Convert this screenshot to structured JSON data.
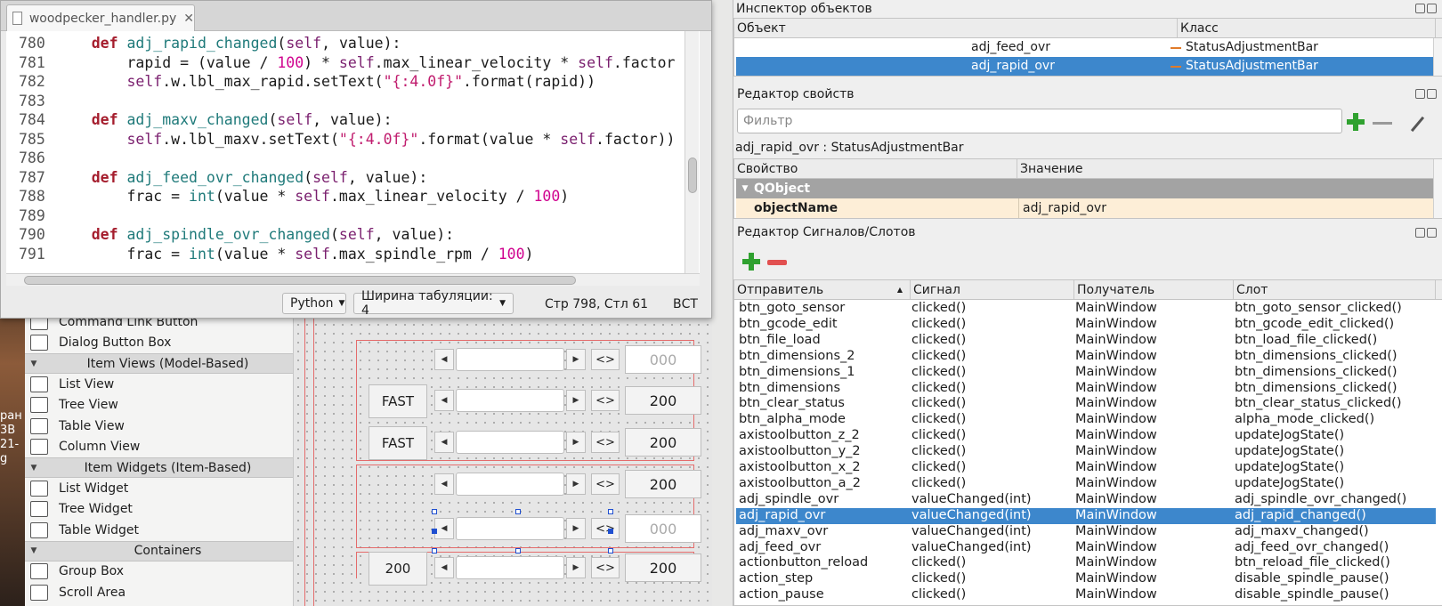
{
  "desktop": {
    "text": "ран\n3B\n21-\ng"
  },
  "widget_box": {
    "items": [
      {
        "type": "item",
        "label": "Command Link Button",
        "icon": "command-link-icon"
      },
      {
        "type": "item",
        "label": "Dialog Button Box",
        "icon": "dialog-button-box-icon"
      },
      {
        "type": "category",
        "label": "Item Views (Model-Based)"
      },
      {
        "type": "item",
        "label": "List View",
        "icon": "list-view-icon"
      },
      {
        "type": "item",
        "label": "Tree View",
        "icon": "tree-view-icon"
      },
      {
        "type": "item",
        "label": "Table View",
        "icon": "table-view-icon"
      },
      {
        "type": "item",
        "label": "Column View",
        "icon": "column-view-icon"
      },
      {
        "type": "category",
        "label": "Item Widgets (Item-Based)"
      },
      {
        "type": "item",
        "label": "List Widget",
        "icon": "list-widget-icon"
      },
      {
        "type": "item",
        "label": "Tree Widget",
        "icon": "tree-widget-icon"
      },
      {
        "type": "item",
        "label": "Table Widget",
        "icon": "table-widget-icon"
      },
      {
        "type": "category",
        "label": "Containers"
      },
      {
        "type": "item",
        "label": "Group Box",
        "icon": "group-box-icon"
      },
      {
        "type": "item",
        "label": "Scroll Area",
        "icon": "scroll-area-icon"
      }
    ]
  },
  "form": {
    "toggle_label": "<>",
    "rows": [
      {
        "label": "",
        "value": "000",
        "value_grey": true
      },
      {
        "label": "FAST",
        "value": "200",
        "value_grey": false
      },
      {
        "label": "FAST",
        "value": "200",
        "value_grey": false
      },
      {
        "label": "",
        "value": "200",
        "value_grey": false
      },
      {
        "label": "",
        "value": "000",
        "value_grey": true
      },
      {
        "label": "200",
        "value": "200",
        "value_grey": false
      }
    ]
  },
  "editor": {
    "tab_title": "woodpecker_handler.py",
    "close_label": "✕",
    "lines": [
      {
        "n": "780",
        "html": "    <span class='kw'>def</span> <span class='fn'>adj_rapid_changed</span>(<span class='self'>self</span>, value):"
      },
      {
        "n": "781",
        "html": "        rapid = (value / <span class='num'>100</span>) * <span class='self'>self</span>.max_linear_velocity * <span class='self'>self</span>.factor"
      },
      {
        "n": "782",
        "html": "        <span class='self'>self</span>.w.lbl_max_rapid.setText(<span class='str'>\"{:4.0f}\"</span>.format(rapid))"
      },
      {
        "n": "783",
        "html": ""
      },
      {
        "n": "784",
        "html": "    <span class='kw'>def</span> <span class='fn'>adj_maxv_changed</span>(<span class='self'>self</span>, value):"
      },
      {
        "n": "785",
        "html": "        <span class='self'>self</span>.w.lbl_maxv.setText(<span class='str'>\"{:4.0f}\"</span>.format(value * <span class='self'>self</span>.factor))"
      },
      {
        "n": "786",
        "html": ""
      },
      {
        "n": "787",
        "html": "    <span class='kw'>def</span> <span class='fn'>adj_feed_ovr_changed</span>(<span class='self'>self</span>, value):"
      },
      {
        "n": "788",
        "html": "        frac = <span class='bi'>int</span>(value * <span class='self'>self</span>.max_linear_velocity / <span class='num'>100</span>)"
      },
      {
        "n": "789",
        "html": ""
      },
      {
        "n": "790",
        "html": "    <span class='kw'>def</span> <span class='fn'>adj_spindle_ovr_changed</span>(<span class='self'>self</span>, value):"
      },
      {
        "n": "791",
        "html": "        frac = <span class='bi'>int</span>(value * <span class='self'>self</span>.max_spindle_rpm / <span class='num'>100</span>)"
      }
    ],
    "status": {
      "language": "Python",
      "tab_width": "Ширина табуляции: 4",
      "position": "Стр 798, Стл 61",
      "mode": "ВСТ"
    }
  },
  "object_inspector": {
    "title": "Инспектор объектов",
    "col_object": "Объект",
    "col_class": "Класс",
    "rows": [
      {
        "name": "adj_feed_ovr",
        "class": "StatusAdjustmentBar",
        "selected": false
      },
      {
        "name": "adj_rapid_ovr",
        "class": "StatusAdjustmentBar",
        "selected": true
      }
    ]
  },
  "property_editor": {
    "title": "Редактор свойств",
    "filter_placeholder": "Фильтр",
    "object_caption": "adj_rapid_ovr : StatusAdjustmentBar",
    "col_property": "Свойство",
    "col_value": "Значение",
    "group": "QObject",
    "prop_name": "objectName",
    "prop_value": "adj_rapid_ovr"
  },
  "signal_slot_editor": {
    "title": "Редактор Сигналов/Слотов",
    "columns": [
      "Отправитель",
      "Сигнал",
      "Получатель",
      "Слот"
    ],
    "rows": [
      [
        "btn_goto_sensor",
        "clicked()",
        "MainWindow",
        "btn_goto_sensor_clicked()"
      ],
      [
        "btn_gcode_edit",
        "clicked()",
        "MainWindow",
        "btn_gcode_edit_clicked()"
      ],
      [
        "btn_file_load",
        "clicked()",
        "MainWindow",
        "btn_load_file_clicked()"
      ],
      [
        "btn_dimensions_2",
        "clicked()",
        "MainWindow",
        "btn_dimensions_clicked()"
      ],
      [
        "btn_dimensions_1",
        "clicked()",
        "MainWindow",
        "btn_dimensions_clicked()"
      ],
      [
        "btn_dimensions",
        "clicked()",
        "MainWindow",
        "btn_dimensions_clicked()"
      ],
      [
        "btn_clear_status",
        "clicked()",
        "MainWindow",
        "btn_clear_status_clicked()"
      ],
      [
        "btn_alpha_mode",
        "clicked()",
        "MainWindow",
        "alpha_mode_clicked()"
      ],
      [
        "axistoolbutton_z_2",
        "clicked()",
        "MainWindow",
        "updateJogState()"
      ],
      [
        "axistoolbutton_y_2",
        "clicked()",
        "MainWindow",
        "updateJogState()"
      ],
      [
        "axistoolbutton_x_2",
        "clicked()",
        "MainWindow",
        "updateJogState()"
      ],
      [
        "axistoolbutton_a_2",
        "clicked()",
        "MainWindow",
        "updateJogState()"
      ],
      [
        "adj_spindle_ovr",
        "valueChanged(int)",
        "MainWindow",
        "adj_spindle_ovr_changed()"
      ],
      [
        "adj_rapid_ovr",
        "valueChanged(int)",
        "MainWindow",
        "adj_rapid_changed()"
      ],
      [
        "adj_maxv_ovr",
        "valueChanged(int)",
        "MainWindow",
        "adj_maxv_changed()"
      ],
      [
        "adj_feed_ovr",
        "valueChanged(int)",
        "MainWindow",
        "adj_feed_ovr_changed()"
      ],
      [
        "actionbutton_reload",
        "clicked()",
        "MainWindow",
        "btn_reload_file_clicked()"
      ],
      [
        "action_step",
        "clicked()",
        "MainWindow",
        "disable_spindle_pause()"
      ],
      [
        "action_pause",
        "clicked()",
        "MainWindow",
        "disable_spindle_pause()"
      ]
    ],
    "selected_index": 13
  }
}
